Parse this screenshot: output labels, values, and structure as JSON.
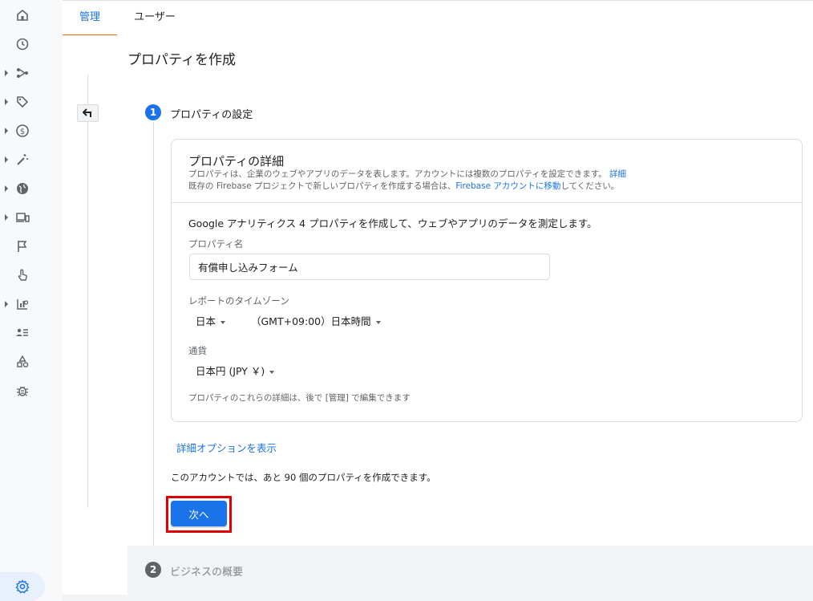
{
  "tabs": [
    {
      "label": "管理",
      "active": true
    },
    {
      "label": "ユーザー",
      "active": false
    }
  ],
  "rail": {
    "items": [
      {
        "icon": "home-icon",
        "expandable": false
      },
      {
        "icon": "clock-icon",
        "expandable": false
      },
      {
        "icon": "flow-icon",
        "expandable": true
      },
      {
        "icon": "tag-icon",
        "expandable": true
      },
      {
        "icon": "dollar-icon",
        "expandable": true
      },
      {
        "icon": "magic-wand-icon",
        "expandable": true
      },
      {
        "icon": "globe-icon",
        "expandable": true
      },
      {
        "icon": "devices-icon",
        "expandable": true
      },
      {
        "icon": "flag-icon",
        "expandable": false
      },
      {
        "icon": "touch-icon",
        "expandable": false
      },
      {
        "icon": "report-icon",
        "expandable": true
      },
      {
        "icon": "audience-icon",
        "expandable": false
      },
      {
        "icon": "shapes-icon",
        "expandable": false
      },
      {
        "icon": "debug-icon",
        "expandable": false
      }
    ],
    "settings_icon": "gear-icon"
  },
  "page": {
    "title": "プロパティを作成"
  },
  "step1": {
    "number": "1",
    "label": "プロパティの設定"
  },
  "card": {
    "title": "プロパティの詳細",
    "desc1_text": "プロパティは、企業のウェブやアプリのデータを表します。アカウントには複数のプロパティを設定できます。",
    "desc1_link": "詳細",
    "desc2_pre": "既存の Firebase プロジェクトで新しいプロパティを作成する場合は、",
    "desc2_link": "Firebase アカウントに移動",
    "desc2_post": "してください。",
    "intro": "Google アナリティクス 4 プロパティを作成して、ウェブやアプリのデータを測定します。",
    "name_label": "プロパティ名",
    "name_value": "有償申し込みフォーム",
    "tz_label": "レポートのタイムゾーン",
    "tz_country": "日本",
    "tz_zone": "（GMT+09:00）日本時間",
    "currency_label": "通貨",
    "currency_value": "日本円 (JPY ￥)",
    "note": "プロパティのこれらの詳細は、後で [管理] で編集できます"
  },
  "advanced_link": "詳細オプションを表示",
  "remaining_text": "このアカウントでは、あと 90 個のプロパティを作成できます。",
  "next_button": "次へ",
  "step2": {
    "number": "2",
    "label": "ビジネスの概要"
  },
  "colors": {
    "accent": "#1a73e8",
    "tab_indicator": "#e8710a",
    "highlight_box": "#e00000"
  }
}
